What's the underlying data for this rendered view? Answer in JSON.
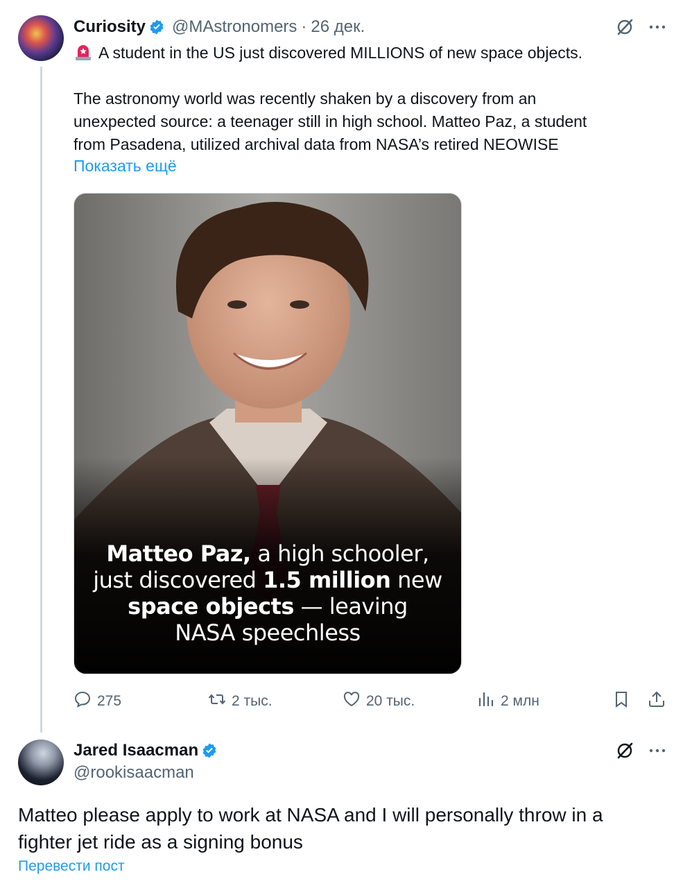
{
  "tweet": {
    "author_name": "Curiosity",
    "handle": "@MAstronomers",
    "separator": "·",
    "date": "26 дек.",
    "headline": "A student in the US just discovered MILLIONS of new space objects.",
    "body_lines": [
      "The astronomy world was recently shaken by a discovery from an",
      "unexpected source: a teenager still in high school. Matteo Paz, a student",
      "from Pasadena, utilized archival data from NASA’s retired NEOWISE"
    ],
    "show_more": "Показать ещё",
    "image_caption": {
      "line1_bold": "Matteo Paz,",
      "line1_rest": " a high schooler,",
      "line2_pre": "just discovered ",
      "line2_bold": "1.5 million",
      "line2_rest": " new",
      "line3_bold": "space objects",
      "line3_rest": " — leaving",
      "line4": "NASA speechless"
    },
    "stats": {
      "replies": "275",
      "reposts": "2 тыс.",
      "likes": "20 тыс.",
      "views": "2 млн"
    }
  },
  "reply": {
    "author_name": "Jared Isaacman",
    "handle": "@rookisaacman",
    "text_lines": [
      "Matteo please apply to work at NASA and I will personally throw in a",
      "fighter jet ride as a signing bonus"
    ],
    "translate": "Перевести пост"
  },
  "colors": {
    "accent": "#1d9bf0",
    "secondary_text": "#536471",
    "verified": "#1d9bf0",
    "alert": "#e0245e"
  }
}
